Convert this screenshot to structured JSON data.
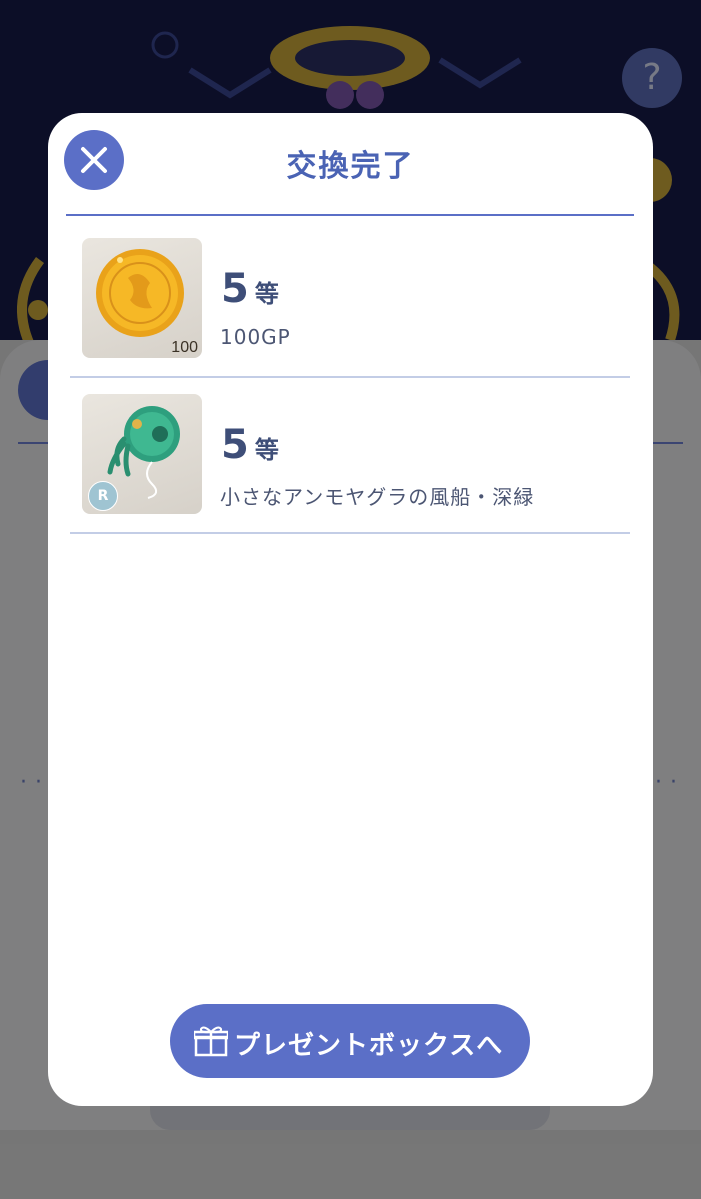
{
  "background": {
    "help_label": "?"
  },
  "modal": {
    "title": "交換完了",
    "items": [
      {
        "rank_number": "5",
        "rank_unit": "等",
        "name": "100GP",
        "thumb_count": "100",
        "thumb_icon": "gold-coin-icon"
      },
      {
        "rank_number": "5",
        "rank_unit": "等",
        "name": "小さなアンモヤグラの風船・深緑",
        "rarity": "R",
        "thumb_icon": "green-balloon-icon"
      }
    ],
    "button_label": "プレゼントボックスへ",
    "button_icon": "gift-box-icon"
  },
  "colors": {
    "accent": "#5b6fc7",
    "title": "#4a63b4",
    "background_navy": "#171b48"
  }
}
